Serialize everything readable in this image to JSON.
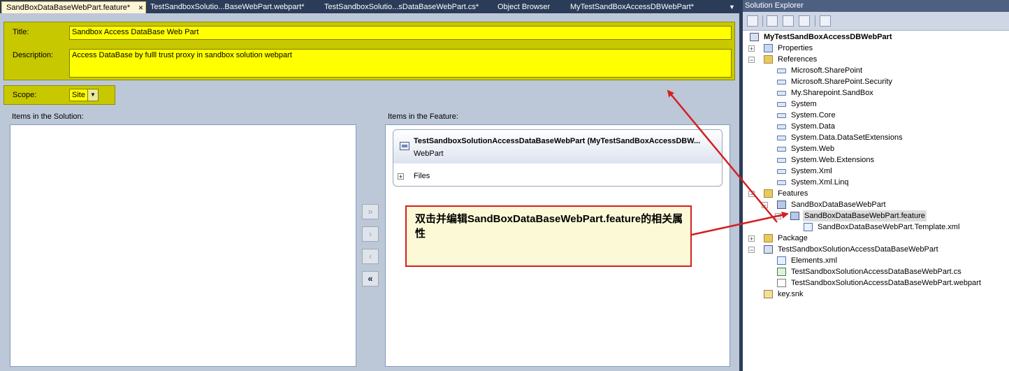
{
  "tabs": [
    {
      "label": "SandBoxDataBaseWebPart.feature*",
      "active": true
    },
    {
      "label": "TestSandboxSolutio...BaseWebPart.webpart*",
      "active": false
    },
    {
      "label": "TestSandboxSolutio...sDataBaseWebPart.cs*",
      "active": false
    },
    {
      "label": "Object Browser",
      "active": false
    },
    {
      "label": "MyTestSandBoxAccessDBWebPart*",
      "active": false
    }
  ],
  "tab_close_glyph": "×",
  "feature": {
    "title_label": "Title:",
    "title_value": "Sandbox Access DataBase  Web Part",
    "description_label": "Description:",
    "description_value": "Access DataBase by fulll trust proxy in sandbox solution webpart",
    "scope_label": "Scope:",
    "scope_value": "Site",
    "items_solution_label": "Items in the Solution:",
    "items_feature_label": "Items in the Feature:",
    "feature_item": {
      "title": "TestSandboxSolutionAccessDataBaseWebPart (MyTestSandBoxAccessDBW...",
      "subtitle": "WebPart",
      "files_label": "Files"
    },
    "move_buttons": [
      {
        "glyph": "»",
        "enabled": false
      },
      {
        "glyph": "›",
        "enabled": false
      },
      {
        "glyph": "‹",
        "enabled": false
      },
      {
        "glyph": "«",
        "enabled": true
      }
    ]
  },
  "callout": {
    "text": "双击并编辑SandBoxDataBaseWebPart.feature的相关属性"
  },
  "solution_explorer": {
    "title": "Solution Explorer",
    "tree": [
      {
        "label": "MyTestSandBoxAccessDBWebPart",
        "level": 0,
        "expander": "",
        "icon": "project-icon",
        "bold": true
      },
      {
        "label": "Properties",
        "level": 1,
        "expander": "+",
        "icon": "properties-icon"
      },
      {
        "label": "References",
        "level": 1,
        "expander": "-",
        "icon": "references-folder-icon"
      },
      {
        "label": "Microsoft.SharePoint",
        "level": 2,
        "expander": "",
        "icon": "reference-icon"
      },
      {
        "label": "Microsoft.SharePoint.Security",
        "level": 2,
        "expander": "",
        "icon": "reference-icon"
      },
      {
        "label": "My.Sharepoint.SandBox",
        "level": 2,
        "expander": "",
        "icon": "reference-icon"
      },
      {
        "label": "System",
        "level": 2,
        "expander": "",
        "icon": "reference-icon"
      },
      {
        "label": "System.Core",
        "level": 2,
        "expander": "",
        "icon": "reference-icon"
      },
      {
        "label": "System.Data",
        "level": 2,
        "expander": "",
        "icon": "reference-icon"
      },
      {
        "label": "System.Data.DataSetExtensions",
        "level": 2,
        "expander": "",
        "icon": "reference-icon"
      },
      {
        "label": "System.Web",
        "level": 2,
        "expander": "",
        "icon": "reference-icon"
      },
      {
        "label": "System.Web.Extensions",
        "level": 2,
        "expander": "",
        "icon": "reference-icon"
      },
      {
        "label": "System.Xml",
        "level": 2,
        "expander": "",
        "icon": "reference-icon"
      },
      {
        "label": "System.Xml.Linq",
        "level": 2,
        "expander": "",
        "icon": "reference-icon"
      },
      {
        "label": "Features",
        "level": 1,
        "expander": "-",
        "icon": "features-folder-icon"
      },
      {
        "label": "SandBoxDataBaseWebPart",
        "level": 2,
        "expander": "-",
        "icon": "feature-icon"
      },
      {
        "label": "SandBoxDataBaseWebPart.feature",
        "level": 3,
        "expander": "-",
        "icon": "feature-file-icon",
        "selected": true
      },
      {
        "label": "SandBoxDataBaseWebPart.Template.xml",
        "level": 4,
        "expander": "",
        "icon": "xml-file-icon"
      },
      {
        "label": "Package",
        "level": 1,
        "expander": "+",
        "icon": "package-icon"
      },
      {
        "label": "TestSandboxSolutionAccessDataBaseWebPart",
        "level": 1,
        "expander": "-",
        "icon": "webpart-folder-icon"
      },
      {
        "label": "Elements.xml",
        "level": 2,
        "expander": "",
        "icon": "xml-file-icon"
      },
      {
        "label": "TestSandboxSolutionAccessDataBaseWebPart.cs",
        "level": 2,
        "expander": "",
        "icon": "cs-file-icon"
      },
      {
        "label": "TestSandboxSolutionAccessDataBaseWebPart.webpart",
        "level": 2,
        "expander": "",
        "icon": "file-icon"
      },
      {
        "label": "key.snk",
        "level": 1,
        "expander": "",
        "icon": "key-file-icon"
      }
    ]
  },
  "colors": {
    "annotation_red": "#d42020",
    "field_yellow": "#ffff00",
    "panel_olive": "#c8c800",
    "tab_strip": "#2b3c59"
  }
}
